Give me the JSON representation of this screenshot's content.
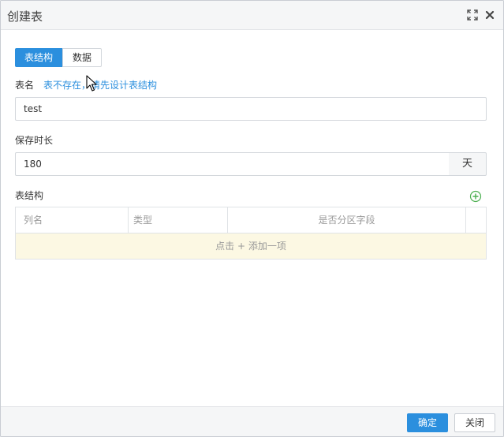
{
  "dialog": {
    "title": "创建表"
  },
  "tabs": [
    {
      "label": "表结构",
      "active": true
    },
    {
      "label": "数据",
      "active": false
    }
  ],
  "table_name": {
    "label": "表名",
    "hint": "表不存在，请先设计表结构",
    "value": "test"
  },
  "retention": {
    "label": "保存时长",
    "value": "180",
    "unit": "天"
  },
  "schema": {
    "label": "表结构",
    "columns": [
      "列名",
      "类型",
      "是否分区字段"
    ],
    "add_row_label": "点击 + 添加一项"
  },
  "footer": {
    "ok_label": "确定",
    "close_label": "关闭"
  },
  "colors": {
    "primary": "#2b8fde",
    "add_icon": "#4caf50",
    "add_row_bg": "#fcf8e3"
  },
  "icons": [
    "maximize-icon",
    "close-icon",
    "add-circle-icon"
  ]
}
